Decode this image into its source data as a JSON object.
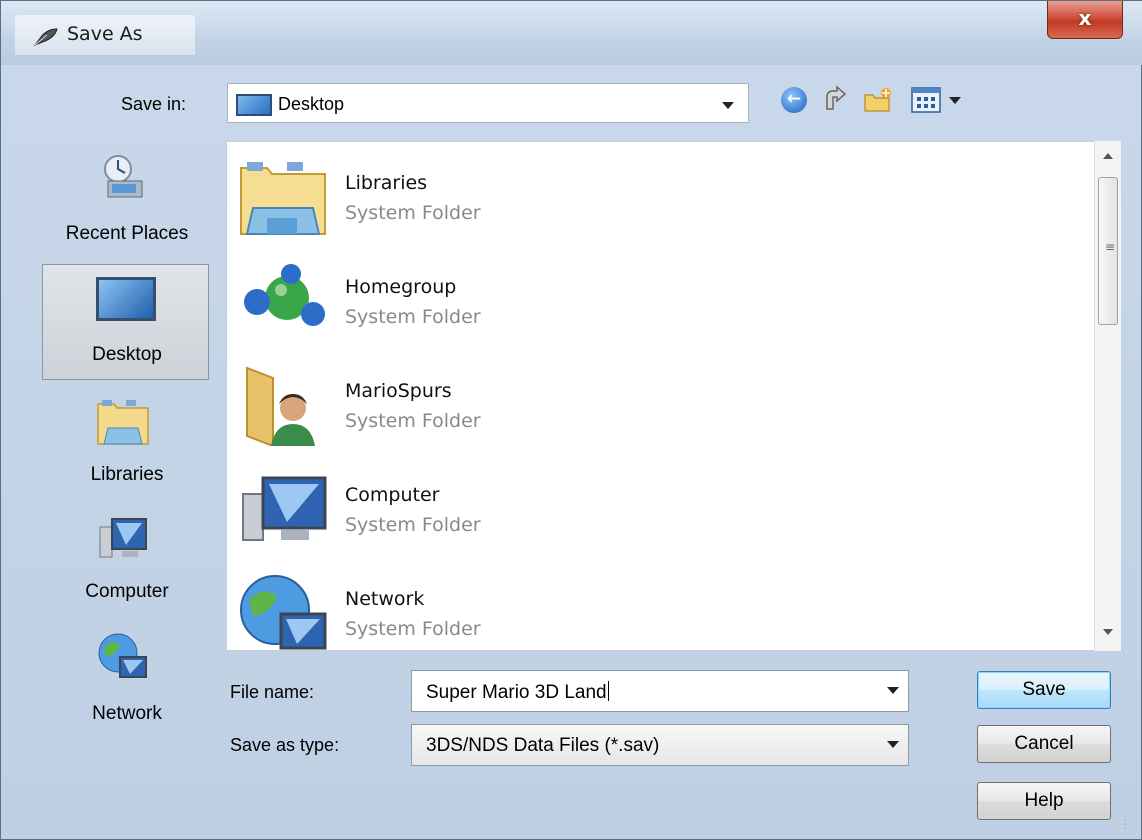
{
  "window": {
    "title": "Save As",
    "close_glyph": "x"
  },
  "toolbar": {
    "save_in_label": "Save in:",
    "location": "Desktop",
    "icons": [
      "back-icon",
      "up-folder-icon",
      "new-folder-icon",
      "views-menu-icon"
    ]
  },
  "places": [
    {
      "label": "Recent Places",
      "icon": "recent-places-icon"
    },
    {
      "label": "Desktop",
      "icon": "desktop-icon",
      "selected": true
    },
    {
      "label": "Libraries",
      "icon": "libraries-icon"
    },
    {
      "label": "Computer",
      "icon": "computer-icon"
    },
    {
      "label": "Network",
      "icon": "network-icon"
    }
  ],
  "files": [
    {
      "name": "Libraries",
      "type": "System Folder",
      "icon": "libraries-folder-icon"
    },
    {
      "name": "Homegroup",
      "type": "System Folder",
      "icon": "homegroup-icon"
    },
    {
      "name": "MarioSpurs",
      "type": "System Folder",
      "icon": "user-folder-icon"
    },
    {
      "name": "Computer",
      "type": "System Folder",
      "icon": "computer-icon"
    },
    {
      "name": "Network",
      "type": "System Folder",
      "icon": "network-icon"
    }
  ],
  "form": {
    "file_name_label": "File name:",
    "file_name_value": "Super Mario 3D Land",
    "save_type_label": "Save as type:",
    "save_type_value": "3DS/NDS Data Files (*.sav)"
  },
  "buttons": {
    "save": "Save",
    "cancel": "Cancel",
    "help": "Help"
  },
  "colors": {
    "accent": "#3c7fb1",
    "close": "#c23a25"
  }
}
